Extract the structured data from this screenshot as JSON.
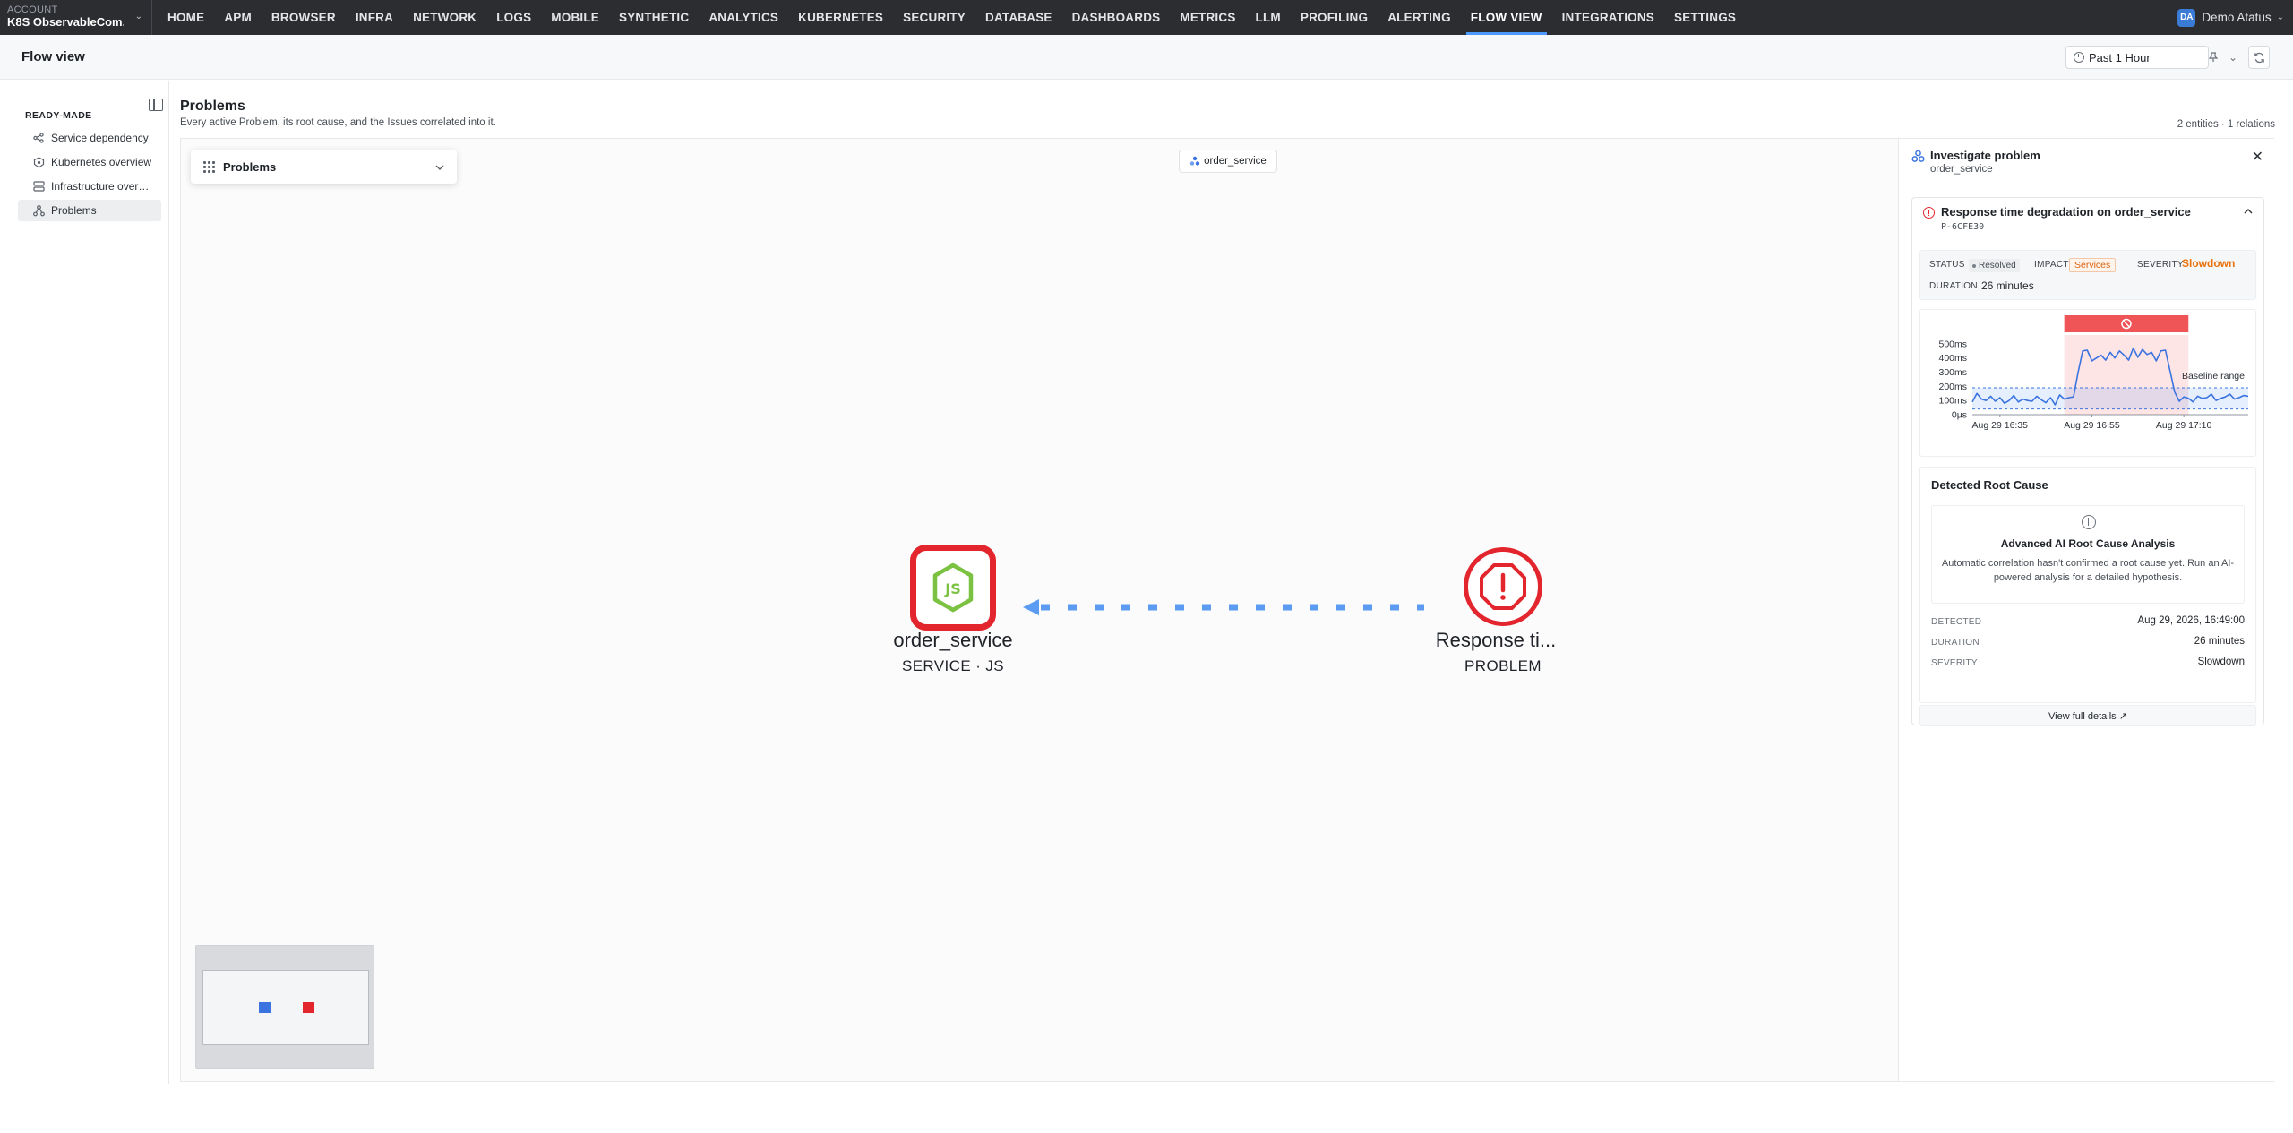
{
  "account": {
    "label": "ACCOUNT",
    "name": "K8S ObservableCom..."
  },
  "nav": {
    "items": [
      "HOME",
      "APM",
      "BROWSER",
      "INFRA",
      "NETWORK",
      "LOGS",
      "MOBILE",
      "SYNTHETIC",
      "ANALYTICS",
      "KUBERNETES",
      "SECURITY",
      "DATABASE",
      "DASHBOARDS",
      "METRICS",
      "LLM",
      "PROFILING",
      "ALERTING",
      "FLOW VIEW",
      "INTEGRATIONS",
      "SETTINGS"
    ],
    "active": "FLOW VIEW"
  },
  "user": {
    "initials": "DA",
    "name": "Demo Atatus"
  },
  "page": {
    "title": "Flow view"
  },
  "timepicker": {
    "value": "Past 1 Hour"
  },
  "sidebar": {
    "section": "READY-MADE",
    "items": [
      {
        "label": "Service dependency",
        "icon": "share-nodes-icon"
      },
      {
        "label": "Kubernetes overview",
        "icon": "helm-icon"
      },
      {
        "label": "Infrastructure overvi...",
        "icon": "server-icon"
      },
      {
        "label": "Problems",
        "icon": "nodes-tree-icon",
        "active": true
      }
    ]
  },
  "content": {
    "title": "Problems",
    "subtitle": "Every active Problem, its root cause, and the Issues correlated into it.",
    "entity_count": "2 entities · 1 relations"
  },
  "canvas": {
    "view_select": "Problems",
    "focus_pill": "order_service",
    "service_node": {
      "name": "order_service",
      "sub": "SERVICE · JS"
    },
    "problem_node": {
      "name": "Response ti...",
      "sub": "PROBLEM"
    }
  },
  "panel": {
    "title": "Investigate problem",
    "subtitle": "order_service",
    "problem": {
      "title": "Response time degradation on order_service",
      "id": "P-6CFE30",
      "status_label": "STATUS",
      "status": "Resolved",
      "impact_label": "IMPACT",
      "impact": "Services",
      "severity_label": "SEVERITY",
      "severity": "Slowdown",
      "duration_label": "DURATION",
      "duration": "26 minutes"
    },
    "chart": {
      "baseline_label": "Baseline range"
    },
    "root_cause": {
      "title": "Detected Root Cause",
      "ai_title": "Advanced AI Root Cause Analysis",
      "ai_desc": "Automatic correlation hasn't confirmed a root cause yet. Run an AI-powered analysis for a detailed hypothesis.",
      "detected_label": "DETECTED",
      "detected": "Aug 29, 2026, 16:49:00",
      "duration_label": "DURATION",
      "duration": "26 minutes",
      "severity_label": "SEVERITY",
      "severity": "Slowdown"
    },
    "view_details": "View full details ↗"
  },
  "chart_data": {
    "type": "line",
    "title": "",
    "xlabel": "",
    "ylabel": "",
    "y_ticks": [
      "0µs",
      "100ms",
      "200ms",
      "300ms",
      "400ms",
      "500ms"
    ],
    "x_ticks": [
      "Aug 29 16:35",
      "Aug 29 16:55",
      "Aug 29 17:10"
    ],
    "ylim": [
      0,
      550
    ],
    "baseline_range": [
      40,
      190
    ],
    "baseline_label": "Baseline range",
    "problem_window_minutes": [
      20,
      47
    ],
    "x_minutes": [
      0,
      1,
      2,
      3,
      4,
      5,
      6,
      7,
      8,
      9,
      10,
      11,
      12,
      13,
      14,
      15,
      16,
      17,
      18,
      19,
      20,
      21,
      22,
      23,
      24,
      25,
      26,
      27,
      28,
      29,
      30,
      31,
      32,
      33,
      34,
      35,
      36,
      37,
      38,
      39,
      40,
      41,
      42,
      43,
      44,
      45,
      46,
      47,
      48,
      49,
      50,
      51,
      52,
      53,
      54,
      55,
      56,
      57,
      58,
      59,
      60
    ],
    "series": [
      {
        "values": [
          90,
          150,
          110,
          100,
          130,
          95,
          120,
          80,
          100,
          135,
          90,
          110,
          100,
          95,
          130,
          105,
          85,
          120,
          70,
          140,
          110,
          120,
          125,
          300,
          450,
          455,
          380,
          400,
          420,
          385,
          440,
          400,
          450,
          420,
          385,
          470,
          405,
          460,
          425,
          440,
          380,
          450,
          455,
          310,
          160,
          95,
          125,
          115,
          90,
          130,
          115,
          120,
          145,
          100,
          115,
          125,
          145,
          110,
          120,
          135,
          130
        ]
      }
    ]
  }
}
